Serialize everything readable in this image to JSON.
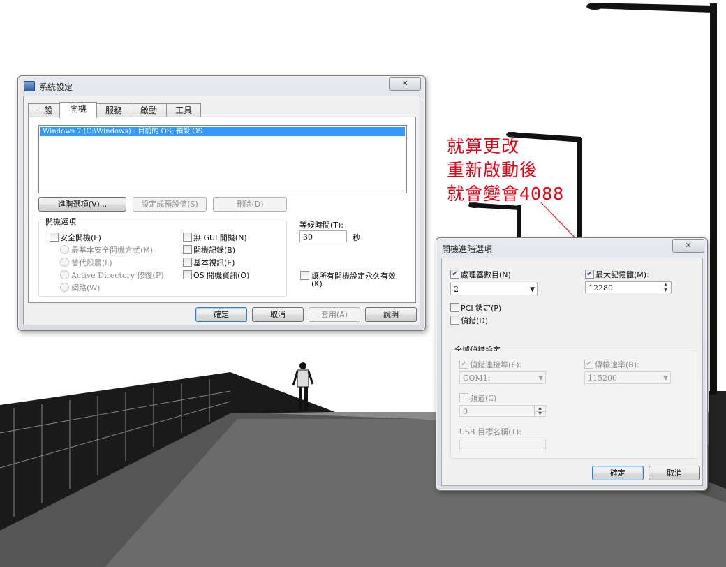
{
  "scene": {
    "description_colors": {
      "sky": "#ffffff",
      "ground": "#4a4a4a"
    }
  },
  "system_config": {
    "title": "系統設定",
    "close_label": "✕",
    "tabs": [
      {
        "label": "一般"
      },
      {
        "label": "開機"
      },
      {
        "label": "服務"
      },
      {
        "label": "啟動"
      },
      {
        "label": "工具"
      }
    ],
    "os_list": [
      "Windows 7 (C:\\Windows) : 目前的 OS; 預設 OS"
    ],
    "advanced_button": "進階選項(V)...",
    "set_default_button": "設定成預設值(S)",
    "delete_button": "刪除(D)",
    "boot_options": {
      "legend": "開機選項",
      "safe_boot": "安全開機(F)",
      "minimal": "最基本安全開機方式(M)",
      "alternate_shell": "替代殼層(L)",
      "ad_repair": "Active Directory 修復(P)",
      "network": "網路(W)",
      "no_gui": "無 GUI 開機(N)",
      "boot_log": "開機記錄(B)",
      "base_video": "基本視訊(E)",
      "os_boot_info": "OS 開機資訊(O)"
    },
    "timeout_label": "等候時間(T):",
    "timeout_value": "30",
    "timeout_unit": "秒",
    "permanent_label": "讓所有開機設定永久有效",
    "permanent_label_2": "(K)",
    "ok": "確定",
    "cancel": "取消",
    "apply": "套用(A)",
    "help": "說明"
  },
  "advanced_dialog": {
    "title": "開機進階選項",
    "close_label": "✕",
    "num_proc_label": "處理器數目(N):",
    "num_proc_checked": true,
    "num_proc_value": "2",
    "max_mem_label": "最大記憶體(M):",
    "max_mem_checked": true,
    "max_mem_value": "12280",
    "pci_lock": "PCI 鎖定(P)",
    "debug": "偵錯(D)",
    "global_debug": {
      "legend": "全域偵錯設定",
      "debug_port_label": "偵錯連接埠(E):",
      "debug_port_value": "COM1:",
      "baud_label": "傳輸速率(B):",
      "baud_value": "115200",
      "channel_label": "頻道(C)",
      "channel_value": "0",
      "usb_target_label": "USB 目標名稱(T):",
      "usb_target_value": ""
    },
    "ok": "確定",
    "cancel": "取消"
  },
  "annotation": {
    "color": "#e60012",
    "lines": [
      "就算更改",
      "重新啟動後",
      "就會變會4088"
    ]
  }
}
